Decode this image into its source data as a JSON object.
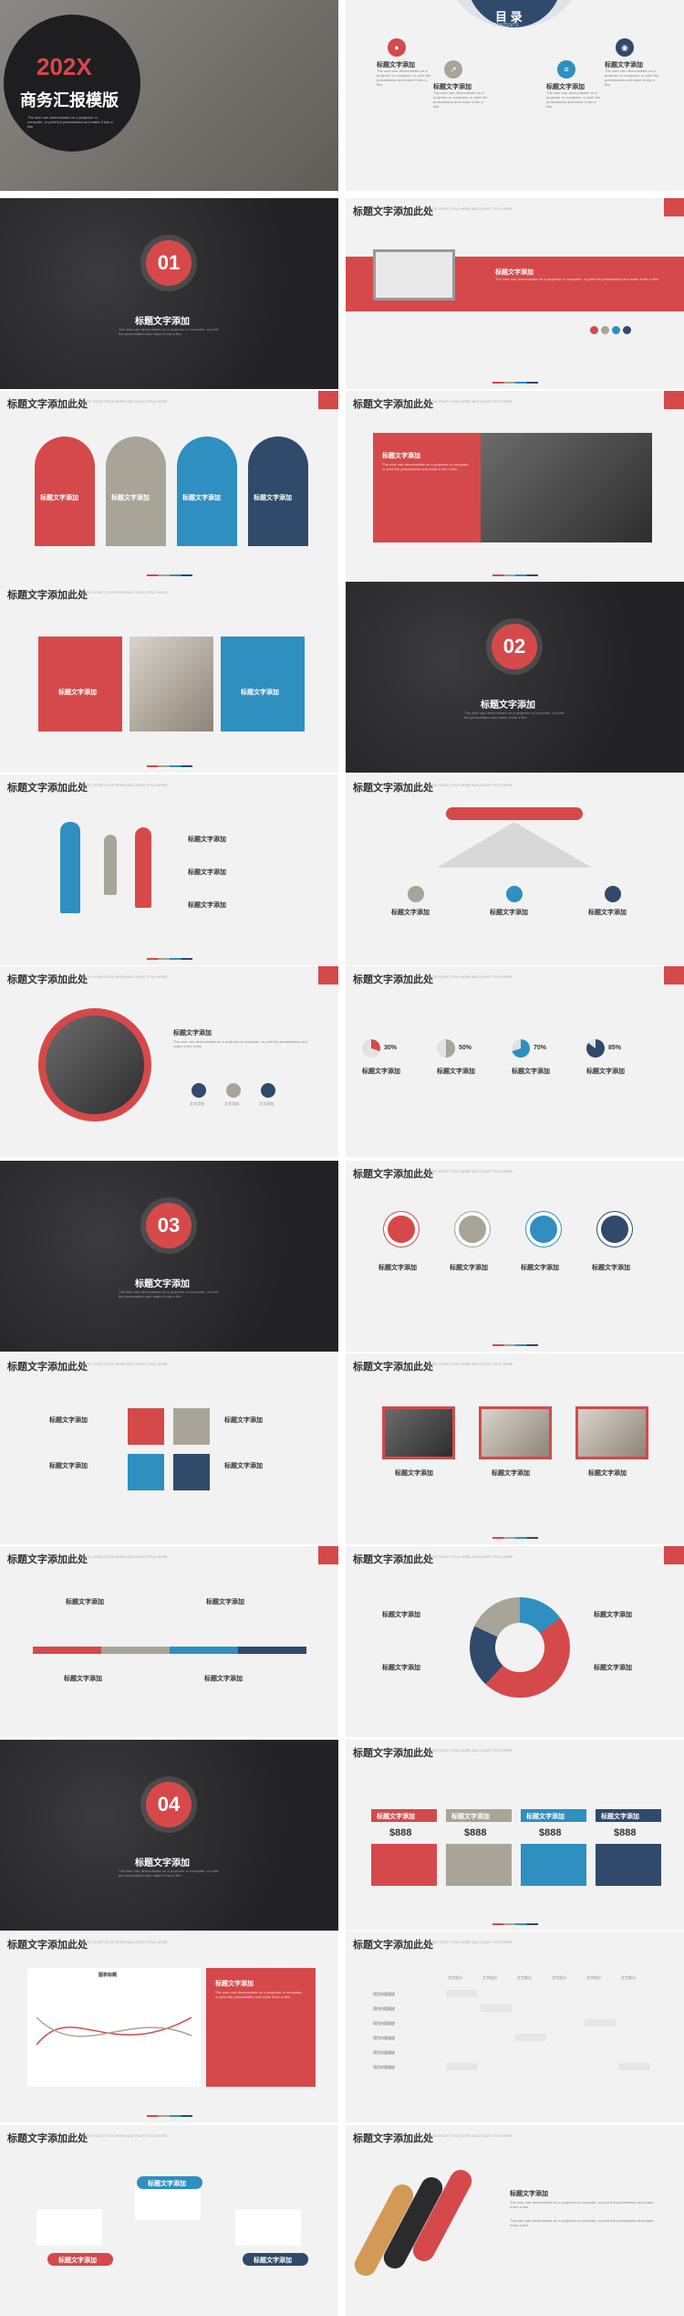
{
  "cover": {
    "year": "202X",
    "title": "商务汇报模版",
    "body": "The user can demonstrate on a projector or computer, or print the presentation and make it into a film"
  },
  "contents": {
    "title": "目 录",
    "subtitle": "CONTENTS",
    "items": [
      {
        "label": "标题文字添加",
        "body": "The user can demonstrate on a projector or computer, or print the presentation and make it into a film"
      },
      {
        "label": "标题文字添加",
        "body": "The user can demonstrate on a projector or computer, or print the presentation and make it into a film"
      },
      {
        "label": "标题文字添加",
        "body": "The user can demonstrate on a projector or computer, or print the presentation and make it into a film"
      },
      {
        "label": "标题文字添加",
        "body": "The user can demonstrate on a projector or computer, or print the presentation and make it into a film"
      }
    ]
  },
  "slide_header": "标题文字添加此处",
  "slide_header_sub": "ADD YOUR TITLE HERE ADD YOUR TITLE HERE",
  "item_title": "标题文字添加",
  "item_body": "The user can demonstrate on a projector or computer, or print the presentation and make it into a film",
  "short_body": "The user can demonstrate on a projector or computer, or print the presentation and make it into a film.",
  "sections": [
    {
      "number": "01",
      "title": "标题文字添加",
      "body": "The user can demonstrate on a projector or computer, or print the presentation and make it into a film"
    },
    {
      "number": "02",
      "title": "标题文字添加",
      "body": "The user can demonstrate on a projector or computer, or print the presentation and make it into a film"
    },
    {
      "number": "03",
      "title": "标题文字添加",
      "body": "The user can demonstrate on a projector or computer, or print the presentation and make it into a film"
    },
    {
      "number": "04",
      "title": "标题文字添加",
      "body": "The user can demonstrate on a projector or computer, or print the presentation and make it into a film"
    }
  ],
  "text_add": "文字添加",
  "percents": [
    "30%",
    "50%",
    "70%",
    "85%"
  ],
  "percent_values": [
    30,
    50,
    70,
    85
  ],
  "price": "$888",
  "chart_title": "图表标题",
  "table_header": "文字部分",
  "table_row_label": "项目内容描述",
  "colors": {
    "red": "#d6494a",
    "gray": "#a8a498",
    "blue": "#2f8fc0",
    "navy": "#2f4a6b",
    "dark": "#2b2b2d"
  }
}
